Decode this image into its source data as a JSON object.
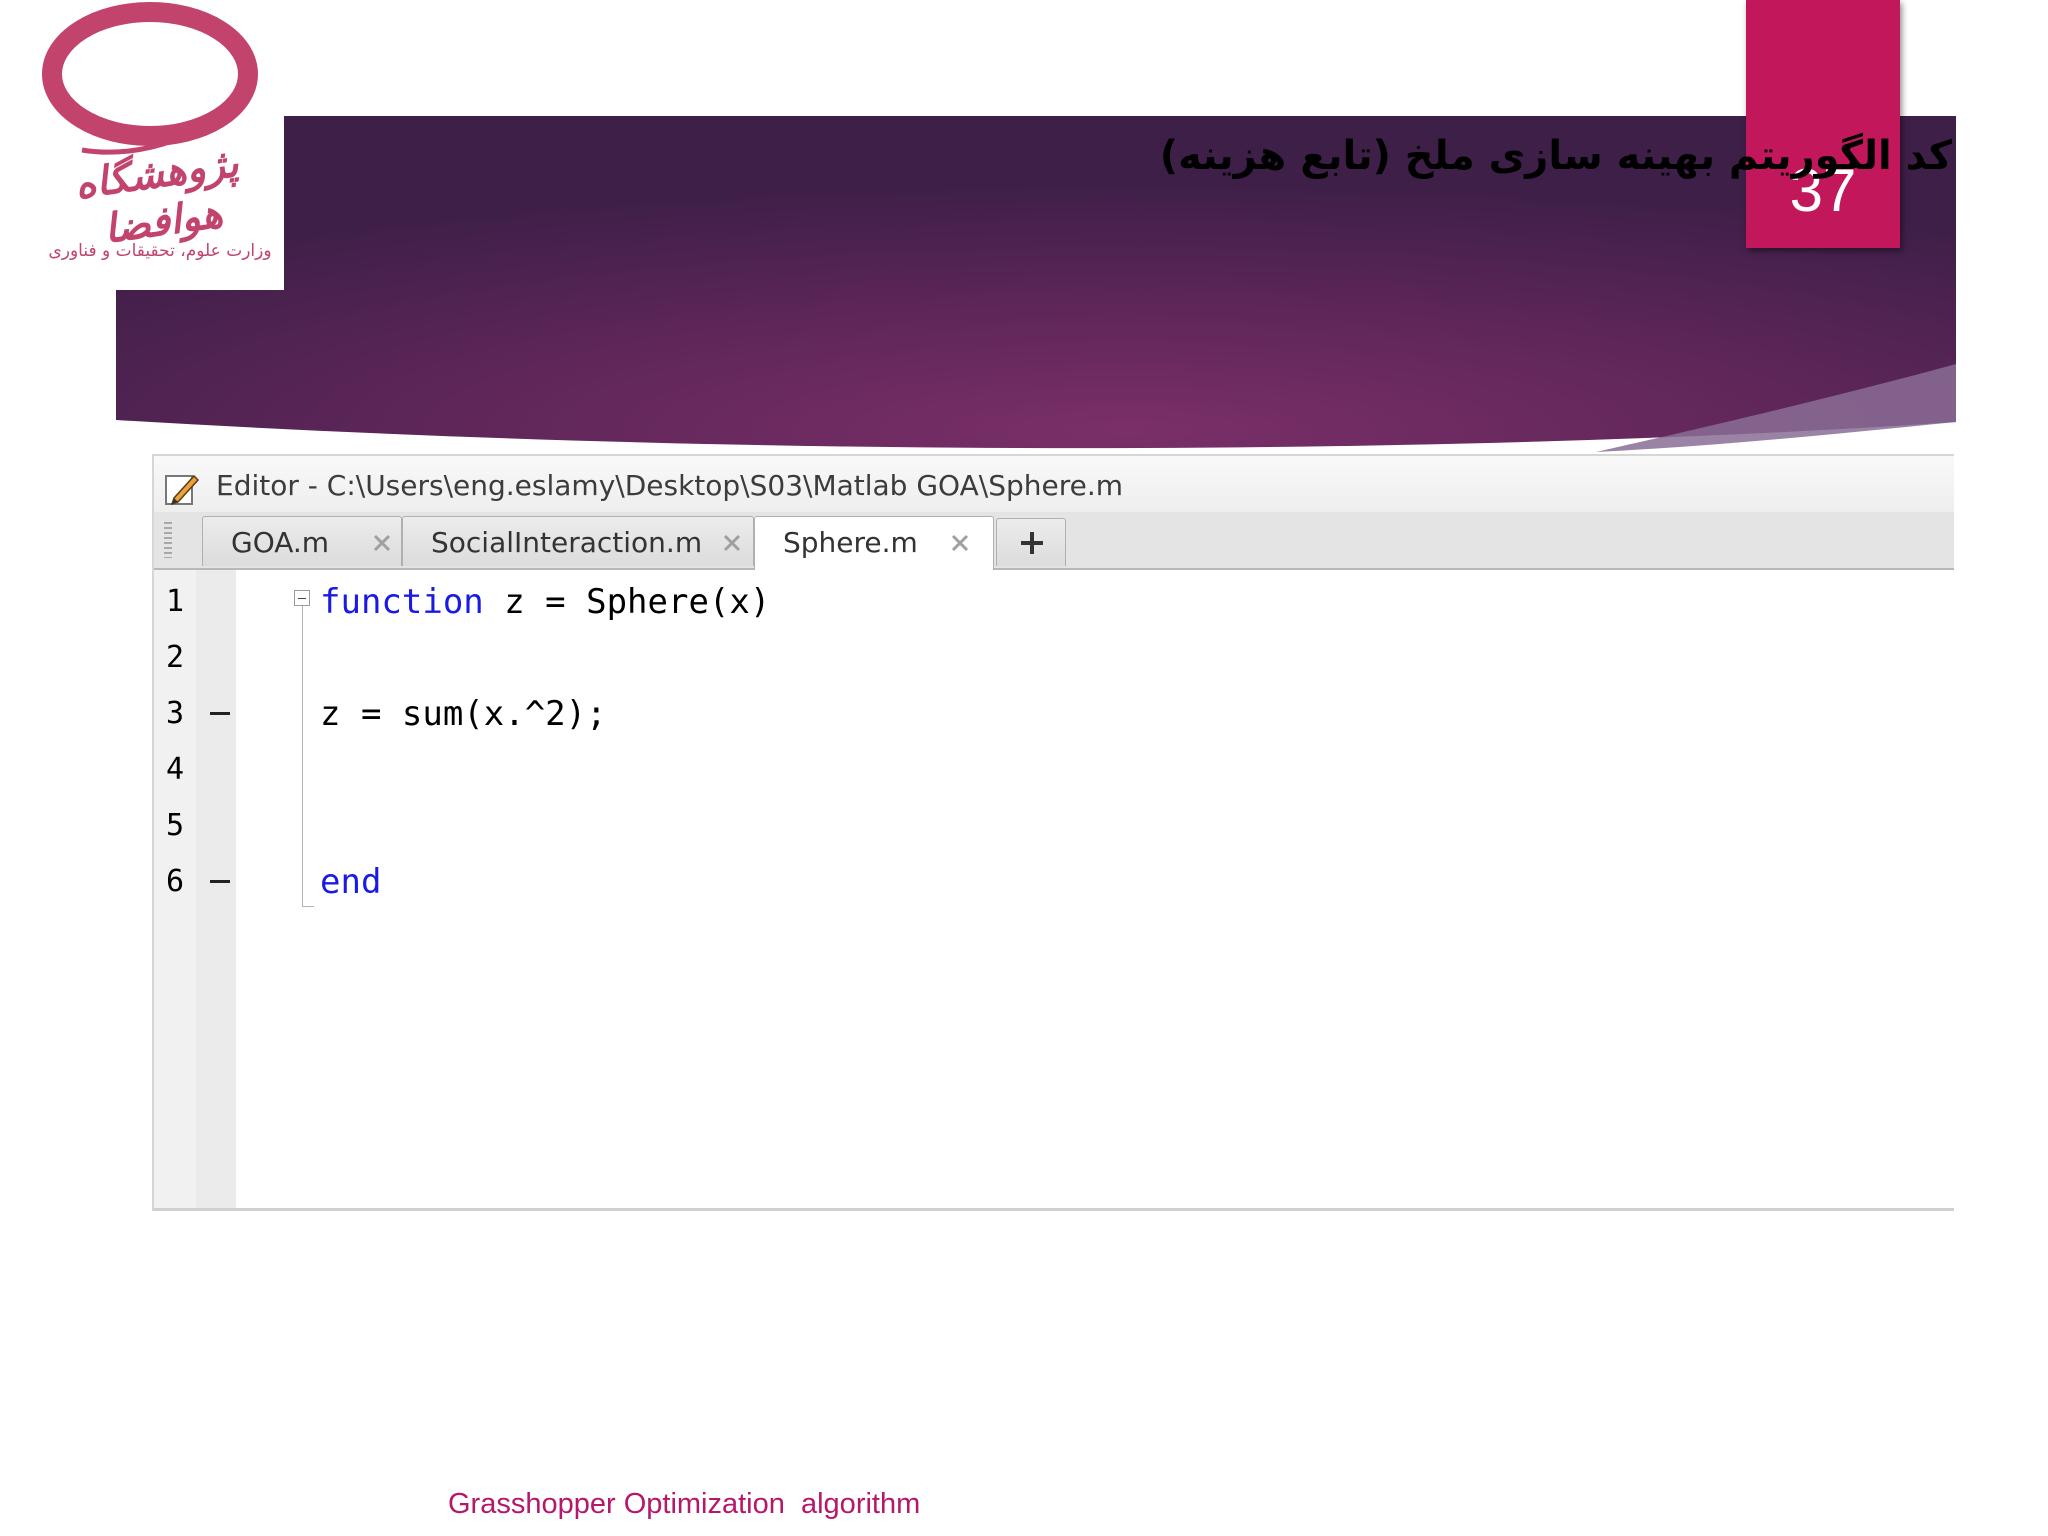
{
  "slide": {
    "number": "37",
    "title": "کد الگوریتم بهینه سازی ملخ (تابع هزینه)",
    "footer": "Grasshopper Optimization  algorithm",
    "accent_color": "#c2185b",
    "banner_color": "#5a2358"
  },
  "logo": {
    "name": "پژوهشگاه هوافضا",
    "subtitle": "وزارت علوم، تحقیقات و فناوری",
    "color": "#c2446c"
  },
  "editor": {
    "title": "Editor - C:\\Users\\eng.eslamy\\Desktop\\S03\\Matlab GOA\\Sphere.m",
    "icon": "pencil-edit-icon",
    "tabs": [
      {
        "label": "GOA.m",
        "active": false,
        "close_icon": "close-icon"
      },
      {
        "label": "SocialInteraction.m",
        "active": false,
        "close_icon": "close-icon"
      },
      {
        "label": "Sphere.m",
        "active": true,
        "close_icon": "close-icon"
      }
    ],
    "add_tab_icon": "plus-icon",
    "lines": [
      {
        "number": "1",
        "keyword": "function",
        "rest": " z = Sphere(x)",
        "marker": false
      },
      {
        "number": "2",
        "keyword": "",
        "rest": "",
        "marker": false
      },
      {
        "number": "3",
        "keyword": "",
        "rest": "z = sum(x.^2);",
        "marker": true
      },
      {
        "number": "4",
        "keyword": "",
        "rest": "",
        "marker": false
      },
      {
        "number": "5",
        "keyword": "",
        "rest": "",
        "marker": false
      },
      {
        "number": "6",
        "keyword": "end",
        "rest": "",
        "marker": true
      }
    ],
    "keyword_color": "#1a1ae6"
  }
}
